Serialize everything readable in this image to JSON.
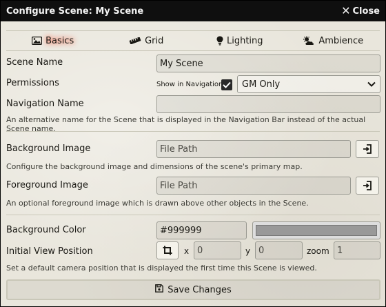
{
  "window": {
    "title": "Configure Scene: My Scene",
    "close_label": "Close"
  },
  "tabs": [
    {
      "label": "Basics",
      "icon": "image-icon",
      "active": true
    },
    {
      "label": "Grid",
      "icon": "ruler-icon",
      "active": false
    },
    {
      "label": "Lighting",
      "icon": "lightbulb-icon",
      "active": false
    },
    {
      "label": "Ambience",
      "icon": "cloud-sun-icon",
      "active": false
    }
  ],
  "form": {
    "scene_name": {
      "label": "Scene Name",
      "value": "My Scene"
    },
    "permissions": {
      "label": "Permissions",
      "show_in_navigation_label": "Show in Navigation",
      "show_in_navigation_checked": true,
      "selected": "GM Only"
    },
    "navigation_name": {
      "label": "Navigation Name",
      "value": "",
      "hint": "An alternative name for the Scene that is displayed in the Navigation Bar instead of the actual Scene name."
    },
    "background_image": {
      "label": "Background Image",
      "placeholder": "File Path",
      "hint": "Configure the background image and dimensions of the scene's primary map."
    },
    "foreground_image": {
      "label": "Foreground Image",
      "placeholder": "File Path",
      "hint": "An optional foreground image which is drawn above other objects in the Scene."
    },
    "background_color": {
      "label": "Background Color",
      "value": "#999999"
    },
    "initial_view": {
      "label": "Initial View Position",
      "x_label": "x",
      "x_placeholder": "0",
      "y_label": "y",
      "y_placeholder": "0",
      "zoom_label": "zoom",
      "zoom_placeholder": "1",
      "hint": "Set a default camera position that is displayed the first time this Scene is viewed."
    }
  },
  "footer": {
    "save_label": "Save Changes"
  },
  "colors": {
    "titlebar": "#0f0f0f",
    "panel": "#e9e6dc",
    "active_glow": "#ff2a00",
    "swatch": "#999999"
  }
}
